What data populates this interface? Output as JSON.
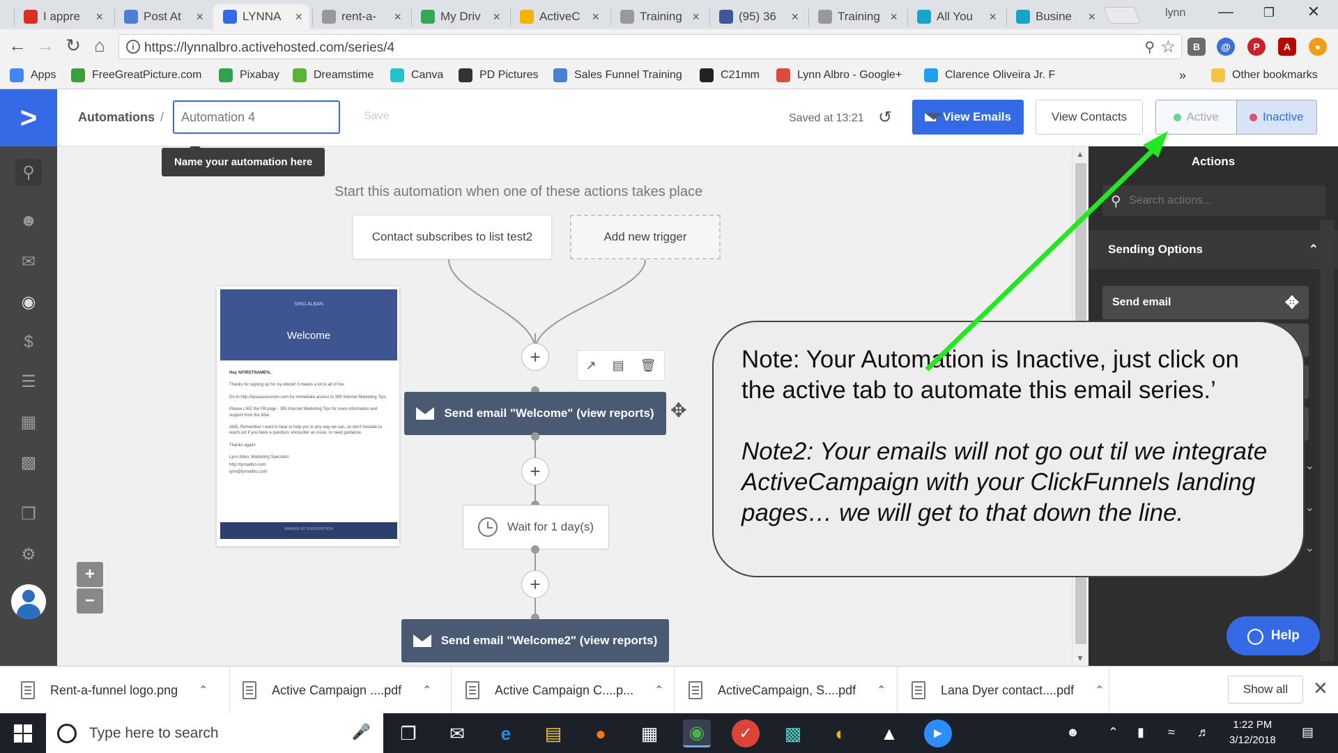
{
  "browser": {
    "tabs": [
      {
        "label": "I appre",
        "icon": "gmail-icon",
        "color": "#d93025"
      },
      {
        "label": "Post At",
        "icon": "chat-icon",
        "color": "#4a7fd4"
      },
      {
        "label": "LYNNA",
        "icon": "activecampaign-icon",
        "color": "#356ae6"
      },
      {
        "label": "rent-a-",
        "icon": "document-icon",
        "color": "#999999"
      },
      {
        "label": "My Driv",
        "icon": "drive-icon",
        "color": "#34a853"
      },
      {
        "label": "ActiveC",
        "icon": "slides-icon",
        "color": "#f4b400"
      },
      {
        "label": "Training",
        "icon": "document-icon",
        "color": "#999999"
      },
      {
        "label": "(95) 36",
        "icon": "facebook-icon",
        "color": "#3b5998"
      },
      {
        "label": "Training",
        "icon": "document-icon",
        "color": "#999999"
      },
      {
        "label": "All You",
        "icon": "clickfunnels-icon",
        "color": "#18a4c4"
      },
      {
        "label": "Busine",
        "icon": "clickfunnels-icon",
        "color": "#18a4c4"
      }
    ],
    "profile_name": "lynn",
    "url": "https://lynnalbro.activehosted.com/series/4",
    "bookmarks": [
      {
        "label": "Apps",
        "icon": "apps-grid-icon",
        "color": "#4285f4"
      },
      {
        "label": "FreeGreatPicture.com",
        "icon": "m-logo-icon",
        "color": "#3c9e3c"
      },
      {
        "label": "Pixabay",
        "icon": "pixabay-icon",
        "color": "#2ea44f"
      },
      {
        "label": "Dreamstime",
        "icon": "dreamstime-icon",
        "color": "#5ab339"
      },
      {
        "label": "Canva",
        "icon": "canva-icon",
        "color": "#20c4cb"
      },
      {
        "label": "PD Pictures",
        "icon": "pd-icon",
        "color": "#333333"
      },
      {
        "label": "Sales Funnel Training",
        "icon": "page-icon",
        "color": "#4a7fd4"
      },
      {
        "label": "C21mm",
        "icon": "c21-icon",
        "color": "#222222"
      },
      {
        "label": "Lynn Albro - Google+",
        "icon": "googleplus-icon",
        "color": "#dd4b39"
      },
      {
        "label": "Clarence Oliveira Jr. F",
        "icon": "twitter-icon",
        "color": "#1da1f2"
      }
    ],
    "other_bookmarks": "Other bookmarks"
  },
  "app": {
    "breadcrumb": "Automations",
    "breadcrumb_sep": "/",
    "automation_name": "Automation 4",
    "save_label": "Save",
    "saved_at": "Saved at 13:21",
    "view_emails": "View Emails",
    "view_contacts": "View Contacts",
    "status_active": "Active",
    "status_inactive": "Inactive",
    "status_inactive_color": "#e0506b",
    "status_active_color": "#6fd38e"
  },
  "canvas": {
    "tooltip": "Name your automation here",
    "start_text": "Start this automation when one of these actions takes place",
    "trigger_1": "Contact subscribes to list test2",
    "trigger_2": "Add new trigger",
    "email_1": "Send email \"Welcome\" (view reports)",
    "wait": "Wait for 1 day(s)",
    "email_2": "Send email \"Welcome2\" (view reports)",
    "preview": {
      "brand": "SING ALBAN",
      "title": "Welcome",
      "lines": [
        "Hey %FIRSTNAME%,",
        "Thanks for signing up for my ebook! It means a lot to all of me.",
        "Go to http://lacasasessions.com for immediate access to 395 Internet Marketing Tips.",
        "Please LIKE the FB page - 395 Internet Marketing Tips for more information and support from the tribe.",
        "AND, Remember I want to hear to help you in any way we can, so don't hesitate to reach out if you have a question, encounter an issue, or need guidance.",
        "Thanks again!",
        "Lynn Albro, Marketing Specialist",
        "http://lynnalbro.com",
        "lynn@lynnalbro.com"
      ],
      "footer": "MANAGE MY SUBSCRIPTION"
    },
    "zoom_in": "+",
    "zoom_out": "−"
  },
  "panel": {
    "title": "Actions",
    "search_placeholder": "Search actions...",
    "section": "Sending Options",
    "items": [
      "Send email"
    ],
    "help": "Help"
  },
  "annotation": {
    "note1": "Note: Your Automation is Inactive, just click on the active tab to automate this email series.’",
    "note2": "Note2: Your emails will not go out til we integrate ActiveCampaign with your ClickFunnels landing pages… we will get to that down the line.",
    "arrow_color": "#22e822"
  },
  "downloads": {
    "items": [
      "Rent-a-funnel logo.png",
      "Active Campaign ....pdf",
      "Active Campaign C....p...",
      "ActiveCampaign, S....pdf",
      "Lana Dyer contact....pdf"
    ],
    "show_all": "Show all"
  },
  "taskbar": {
    "search_placeholder": "Type here to search",
    "time": "1:22 PM",
    "date": "3/12/2018"
  }
}
